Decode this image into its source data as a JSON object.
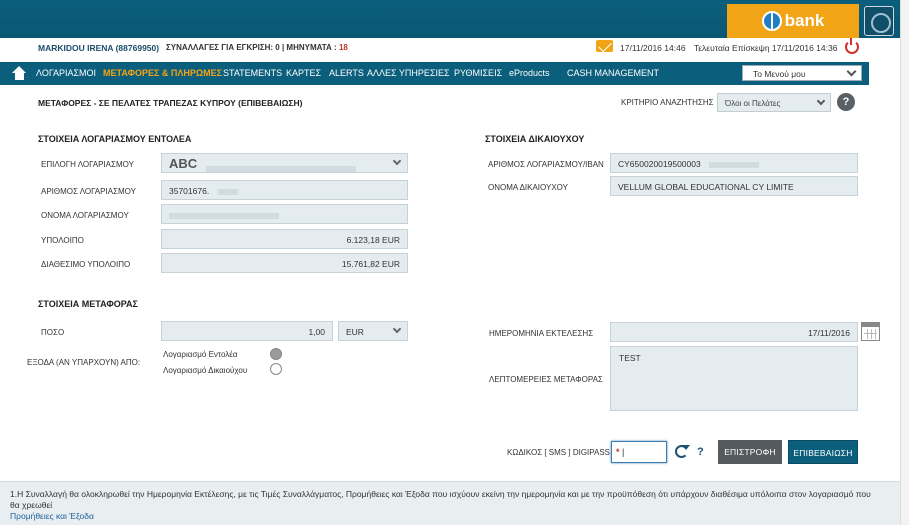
{
  "brand": {
    "logo_text": "bank",
    "accent": "#f2a417",
    "primary": "#0b5f7c"
  },
  "infobar": {
    "user": "MARKIDOU IRENA (88769950)",
    "pending_label": "ΣΥΝΑΛΛΑΓΕΣ ΓΙΑ ΕΓΚΡΙΣΗ: 0 | ΜΗΝΥΜΑΤΑ :",
    "messages_count": "18",
    "datetime": "17/11/2016 14:46",
    "last_visit": "Τελευταία Επίσκεψη 17/11/2016 14:36"
  },
  "nav": {
    "items": [
      "ΛΟΓΑΡΙΑΣΜΟΙ",
      "ΜΕΤΑΦΟΡΕΣ & ΠΛΗΡΩΜΕΣ",
      "STATEMENTS",
      "ΚΑΡΤΕΣ",
      "ALERTS",
      "ΑΛΛΕΣ ΥΠΗΡΕΣΙΕΣ",
      "ΡΥΘΜΙΣΕΙΣ",
      "eProducts",
      "CASH MANAGEMENT"
    ],
    "active_index": 1,
    "menu_select": "Το Μενού μου"
  },
  "page": {
    "title": "ΜΕΤΑΦΟΡΕΣ - ΣΕ ΠΕΛΑΤΕΣ ΤΡΑΠΕΖΑΣ ΚΥΠΡΟΥ (ΕΠΙΒΕΒΑΙΩΣΗ)",
    "criterion_label": "ΚΡΙΤΗΡΙΟ ΑΝΑΖΗΤΗΣΗΣ",
    "criterion_value": "Όλοι οι Πελάτες",
    "help": "?"
  },
  "sender": {
    "title": "ΣΤΟΙΧΕΙΑ ΛΟΓΑΡΙΑΣΜΟΥ ΕΝΤΟΛΕΑ",
    "select_account_label": "ΕΠΙΛΟΓΗ ΛΟΓΑΡΙΑΣΜΟΥ",
    "select_account_value": "ABC",
    "account_number_label": "ΑΡΙΘΜΟΣ ΛΟΓΑΡΙΑΣΜΟΥ",
    "account_number_value": "35701676.",
    "account_name_label": "ΟΝΟΜΑ ΛΟΓΑΡΙΑΣΜΟΥ",
    "balance_label": "ΥΠΟΛΟΙΠΟ",
    "balance_value": "6.123,18 EUR",
    "available_label": "ΔΙΑΘΕΣΙΜΟ ΥΠΟΛΟΙΠΟ",
    "available_value": "15.761,82 EUR"
  },
  "beneficiary": {
    "title": "ΣΤΟΙΧΕΙΑ ΔΙΚΑΙΟΥΧΟΥ",
    "iban_label": "ΑΡΙΘΜΟΣ ΛΟΓΑΡΙΑΣΜΟΥ/IBAN",
    "iban_value": "CY650020019500003",
    "name_label": "ΟΝΟΜΑ ΔΙΚΑΙΟΥΧΟΥ",
    "name_value": "VELLUM GLOBAL EDUCATIONAL CY LIMITE"
  },
  "transfer": {
    "title": "ΣΤΟΙΧΕΙΑ ΜΕΤΑΦΟΡΑΣ",
    "amount_label": "ΠΟΣΟ",
    "amount_value": "1,00",
    "currency_value": "EUR",
    "charges_label": "ΕΞΟΔΑ (ΑΝ ΥΠΑΡΧΟΥΝ) ΑΠΟ:",
    "charges_option_1": "Λογαριασμό Εντολέα",
    "charges_option_2": "Λογαριασμό Δικαιούχου",
    "exec_date_label": "ΗΜΕΡΟΜΗΝΙΑ ΕΚΤΕΛΕΣΗΣ",
    "exec_date_value": "17/11/2016",
    "details_label": "ΛΕΠΤΟΜΕΡΕΙΕΣ ΜΕΤΑΦΟΡΑΣ",
    "details_value": "TEST"
  },
  "auth": {
    "digipass_label": "ΚΩΔΙΚΟΣ [ SMS ] DIGIPASS",
    "digipass_required": "*",
    "help": "?",
    "back_button": "ΕΠΙΣΤΡΟΦΗ",
    "confirm_button": "ΕΠΙΒΕΒΑΙΩΣΗ"
  },
  "footer": {
    "note": "1.Η Συναλλαγή θα ολοκληρωθεί την Ημερομηνία Εκτέλεσης, με τις Τιμές Συναλλάγματος, Προμήθειες και Έξοδα που ισχύουν εκείνη την ημερομηνία και με την προϋπόθεση ότι υπάρχουν διαθέσιμα υπόλοιπα στον λογαριασμό που θα χρεωθεί",
    "link": "Προμήθειες και Έξοδα"
  }
}
